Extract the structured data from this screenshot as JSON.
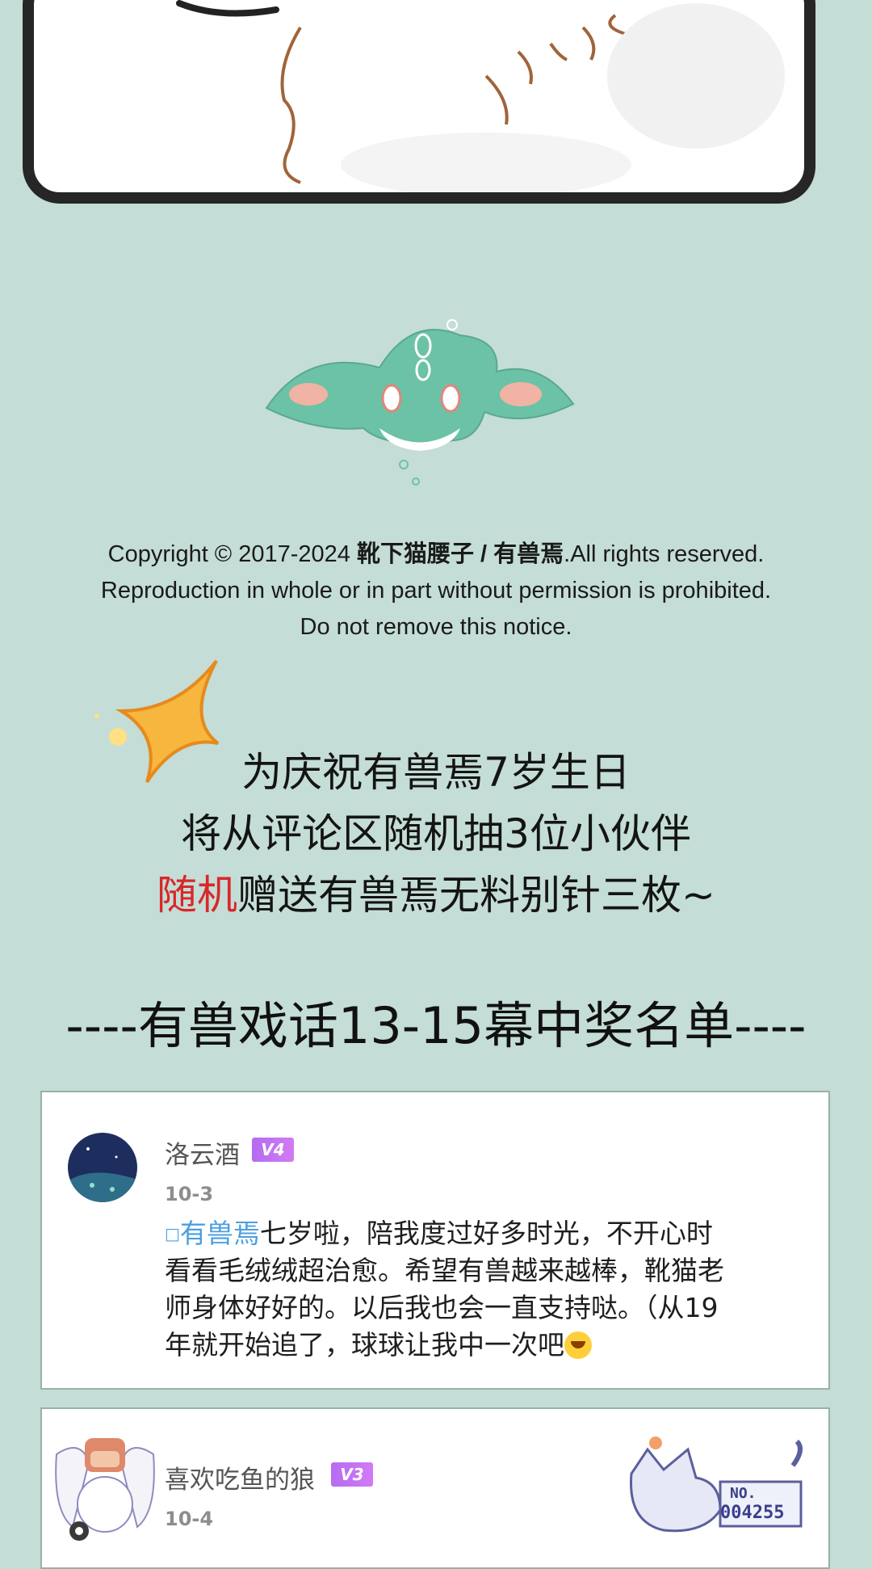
{
  "copyright": {
    "line1_prefix": "Copyright © 2017-2024 ",
    "line1_author": "靴下猫腰子 / 有兽焉",
    "line1_suffix": ".All rights reserved.",
    "line2": "Reproduction in whole or in part without permission is prohibited.",
    "line3": "Do not remove this notice."
  },
  "announcement": {
    "line1": "为庆祝有兽焉7岁生日",
    "line2": "将从评论区随机抽3位小伙伴",
    "line3_highlight": "随机",
    "line3_rest": "赠送有兽焉无料别针三枚~"
  },
  "winners_title": "----有兽戏话13-15幕中奖名单----",
  "comments": [
    {
      "username": "洛云酒",
      "level": "V4",
      "date": "10-3",
      "mention": "有兽焉",
      "text_l1": "七岁啦，陪我度过好多时光，不开心时",
      "text_l2": "看看毛绒绒超治愈。希望有兽越来越棒，靴猫老",
      "text_l3": "师身体好好的。以后我也会一直支持哒。（从19",
      "text_l4": "年就开始追了，球球让我中一次吧"
    },
    {
      "username": "喜欢吃鱼的狼",
      "level": "V3",
      "date": "10-4",
      "badge_no": "NO.",
      "badge_num": "004255"
    }
  ],
  "colors": {
    "background": "#c4ddd6",
    "highlight_red": "#d8282a",
    "mention_blue": "#4b9fe0",
    "vip_purple": "#b56cf0"
  }
}
